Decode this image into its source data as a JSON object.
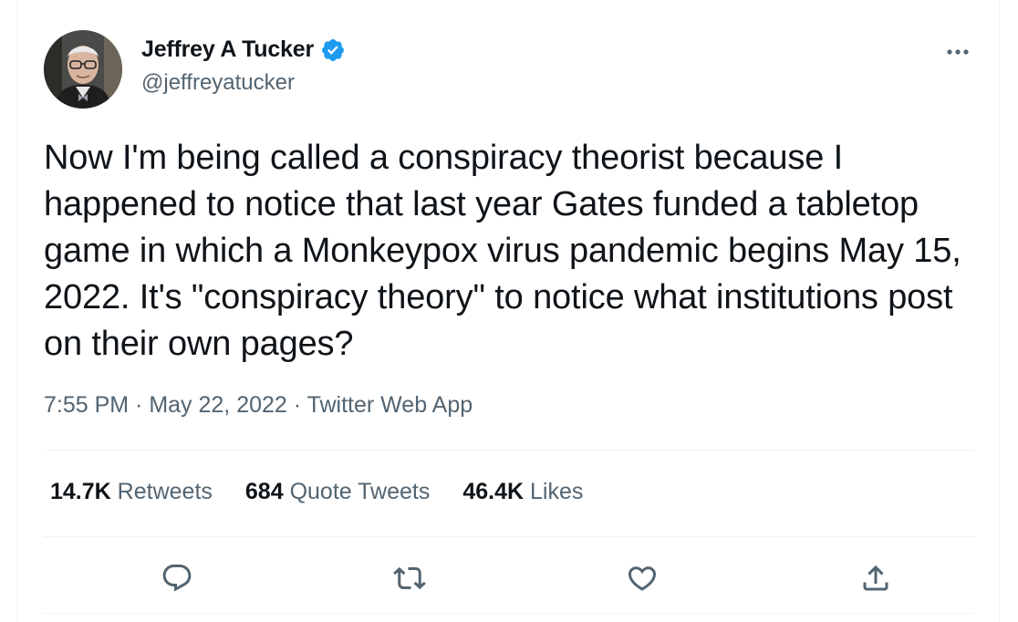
{
  "author": {
    "display_name": "Jeffrey A Tucker",
    "handle": "@jeffreyatucker",
    "verified_icon": "verified-badge-icon",
    "avatar_icon": "avatar"
  },
  "tweet": {
    "text": "Now I'm being called a conspiracy theorist because I happened to notice that last year Gates funded a tabletop game in which a Monkeypox virus pandemic begins May 15, 2022. It's \"conspiracy theory\" to notice what institutions post on their own pages?",
    "time": "7:55 PM",
    "sep1": " · ",
    "date": "May 22, 2022",
    "sep2": " · ",
    "source": "Twitter Web App"
  },
  "stats": [
    {
      "count": "14.7K",
      "label": "Retweets"
    },
    {
      "count": "684",
      "label": "Quote Tweets"
    },
    {
      "count": "46.4K",
      "label": "Likes"
    }
  ],
  "actions": [
    "reply-icon",
    "retweet-icon",
    "like-icon",
    "share-icon"
  ],
  "colors": {
    "text_primary": "#0f1419",
    "text_secondary": "#536471",
    "verified_blue": "#1d9bf0",
    "divider": "#eff3f4"
  }
}
